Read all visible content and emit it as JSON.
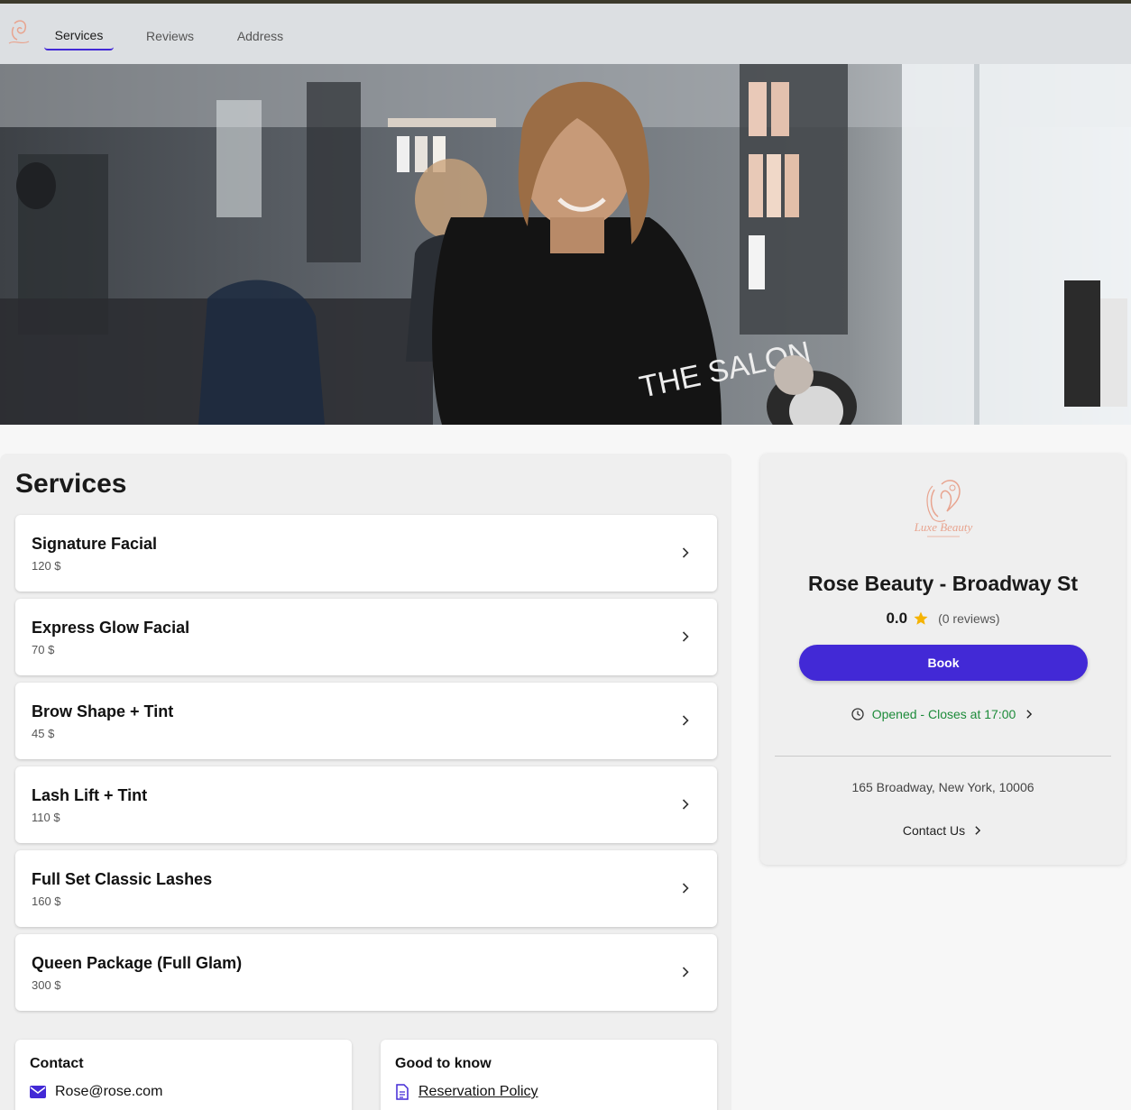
{
  "nav": {
    "tabs": [
      {
        "label": "Services",
        "active": true
      },
      {
        "label": "Reviews",
        "active": false
      },
      {
        "label": "Address",
        "active": false
      }
    ]
  },
  "services": {
    "title": "Services",
    "items": [
      {
        "name": "Signature Facial",
        "price": "120 $"
      },
      {
        "name": "Express Glow Facial",
        "price": "70 $"
      },
      {
        "name": "Brow Shape + Tint",
        "price": "45 $"
      },
      {
        "name": "Lash Lift + Tint",
        "price": "110 $"
      },
      {
        "name": "Full Set Classic Lashes",
        "price": "160 $"
      },
      {
        "name": "Queen Package (Full Glam)",
        "price": "300 $"
      }
    ]
  },
  "contact_card": {
    "title": "Contact",
    "email": "Rose@rose.com"
  },
  "good_to_know": {
    "title": "Good to know",
    "policy_link": "Reservation Policy"
  },
  "sidebar": {
    "logo_text": "Luxe Beauty",
    "salon_name": "Rose Beauty - Broadway St",
    "rating": "0.0",
    "reviews": "(0 reviews)",
    "book_label": "Book",
    "hours": "Opened - Closes at 17:00",
    "address": "165 Broadway, New York, 10006",
    "contact_label": "Contact Us"
  },
  "colors": {
    "accent": "#4229d6",
    "open_status": "#1d8b3a",
    "logo": "#e8a48f",
    "star": "#f5b301"
  }
}
